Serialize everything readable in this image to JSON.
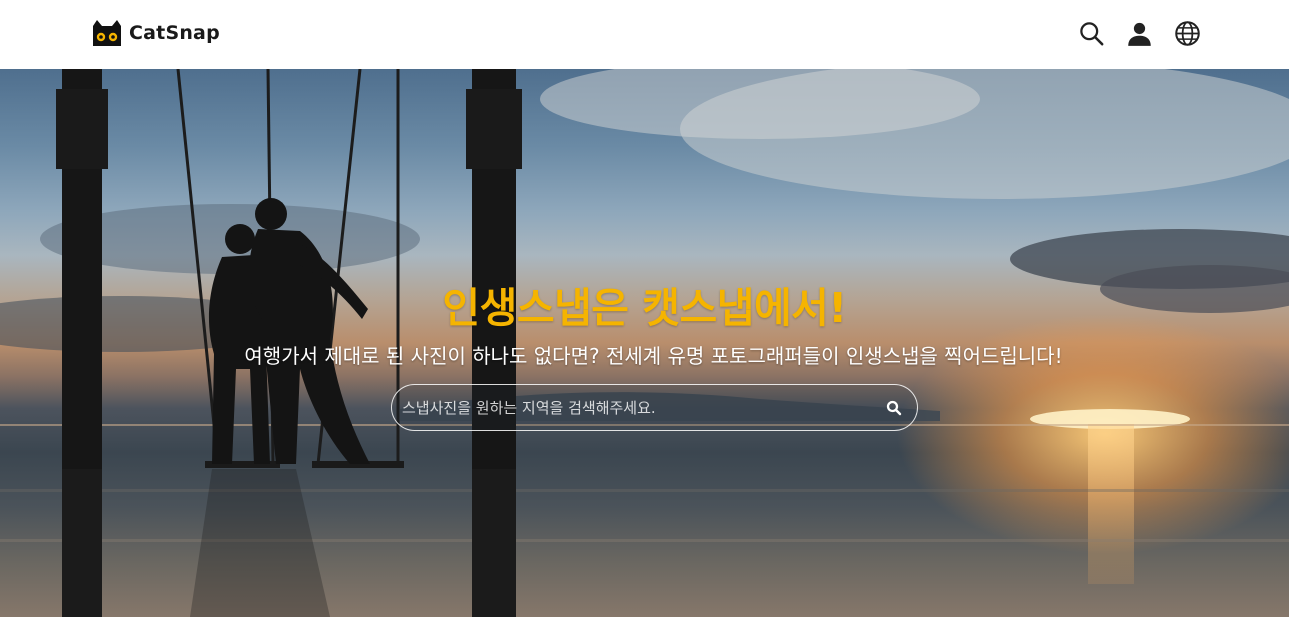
{
  "header": {
    "brand": "CatSnap",
    "icons": [
      "search-icon",
      "user-icon",
      "globe-icon"
    ]
  },
  "hero": {
    "title": "인생스냅은 캣스냅에서!",
    "subtitle": "여행가서 제대로 된 사진이 하나도 없다면? 전세계 유명 포토그래퍼들이 인생스냅을 찍어드립니다!",
    "search": {
      "placeholder": "스냅사진을 원하는 지역을 검색해주세요.",
      "value": ""
    }
  },
  "colors": {
    "accent": "#f5b400",
    "header_bg": "#ffffff",
    "text_dark": "#1a1a1a"
  }
}
